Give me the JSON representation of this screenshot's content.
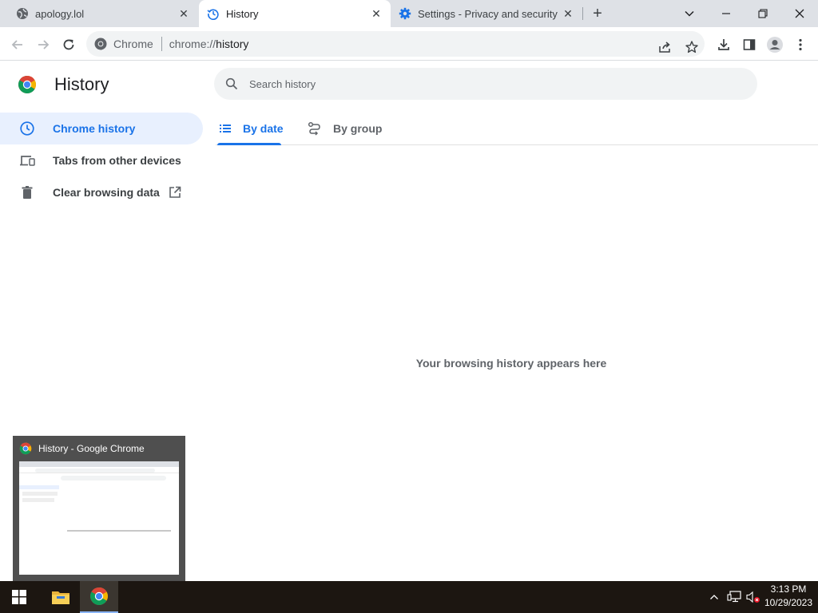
{
  "tabs": [
    {
      "title": "apology.lol",
      "icon": "globe-icon"
    },
    {
      "title": "History",
      "icon": "history-icon"
    },
    {
      "title": "Settings - Privacy and security",
      "icon": "settings-gear-icon"
    }
  ],
  "omnibox": {
    "site_chip": "Chrome",
    "url_scheme": "chrome://",
    "url_host": "history"
  },
  "sidebar": {
    "title": "History",
    "items": [
      {
        "label": "Chrome history",
        "icon": "clock-icon",
        "active": true
      },
      {
        "label": "Tabs from other devices",
        "icon": "devices-icon",
        "active": false
      },
      {
        "label": "Clear browsing data",
        "icon": "trash-icon",
        "active": false
      }
    ]
  },
  "search": {
    "placeholder": "Search history"
  },
  "view_tabs": [
    {
      "label": "By date",
      "icon": "list-icon",
      "active": true
    },
    {
      "label": "By group",
      "icon": "journeys-icon",
      "active": false
    }
  ],
  "empty_message": "Your browsing history appears here",
  "taskbar_preview": {
    "title": "History - Google Chrome"
  },
  "clock": {
    "time": "3:13 PM",
    "date": "10/29/2023"
  },
  "colors": {
    "accent": "#1a73e8",
    "active_nav_bg": "#e8f0fe",
    "tabstrip_bg": "#dee1e6",
    "taskbar_bg": "#1c1611"
  }
}
